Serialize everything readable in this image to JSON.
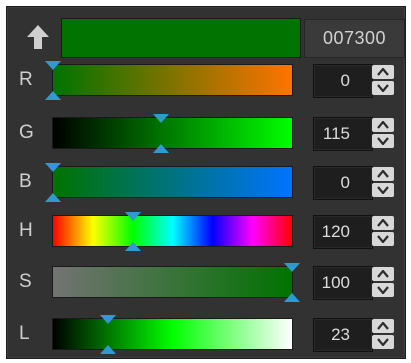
{
  "color": {
    "hex": "007300",
    "swatch": "#007300"
  },
  "sliders": [
    {
      "key": "r",
      "label": "R",
      "value": "0",
      "fraction": 0.0,
      "gradient": "linear-gradient(90deg,#007300,#ff7300)"
    },
    {
      "key": "g",
      "label": "G",
      "value": "115",
      "fraction": 0.451,
      "gradient": "linear-gradient(90deg,#000000,#00ff00)"
    },
    {
      "key": "b",
      "label": "B",
      "value": "0",
      "fraction": 0.0,
      "gradient": "linear-gradient(90deg,#007300,#0073ff)"
    },
    {
      "key": "h",
      "label": "H",
      "value": "120",
      "fraction": 0.333,
      "gradient": "linear-gradient(90deg,#ff0000,#ffff00,#00ff00,#00ffff,#0000ff,#ff00ff,#ff0000)"
    },
    {
      "key": "s",
      "label": "S",
      "value": "100",
      "fraction": 1.0,
      "gradient": "linear-gradient(90deg,#737373,#007300)"
    },
    {
      "key": "l",
      "label": "L",
      "value": "23",
      "fraction": 0.23,
      "gradient": "linear-gradient(90deg,#000000,#00ff00,#ffffff)"
    }
  ],
  "icons": {
    "swap": "up-arrow-icon",
    "spin_up": "chevron-up-icon",
    "spin_down": "chevron-down-icon"
  }
}
